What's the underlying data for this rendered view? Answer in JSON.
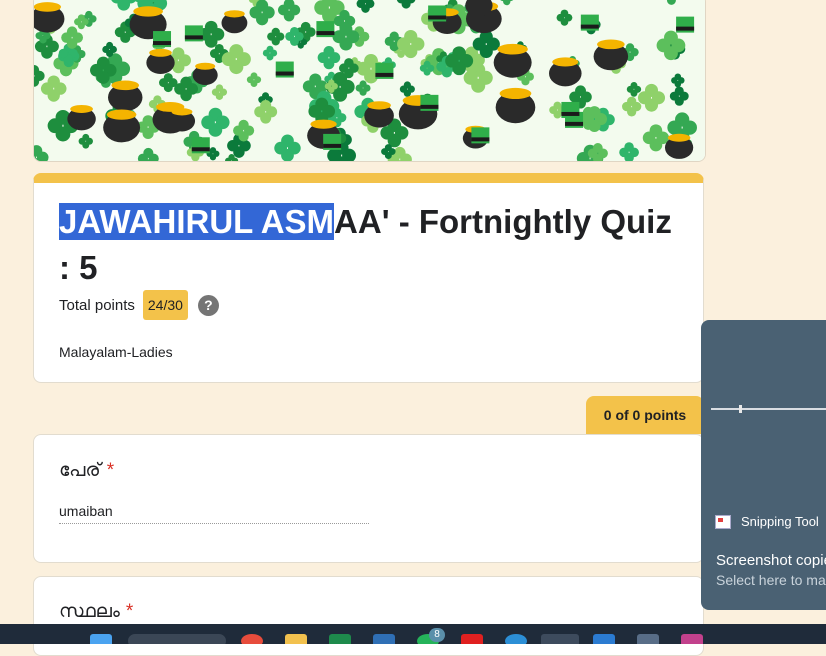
{
  "form": {
    "title_selected": "JAWAHIRUL ASM",
    "title_rest": "AA' - Fortnightly Quiz : 5",
    "total_points_label": "Total points",
    "score": "24/30",
    "help_icon": "help-circle-icon",
    "subtitle": "Malayalam-Ladies"
  },
  "section_points": "0 of 0 points",
  "questions": [
    {
      "label": "പേര്",
      "required_mark": "*",
      "answer": "umaiban"
    },
    {
      "label": "സ്ഥലം",
      "required_mark": "*"
    }
  ],
  "notification": {
    "app_name": "Snipping Tool",
    "heading": "Screenshot copie",
    "body": "Select here to ma"
  },
  "taskbar": {
    "badge_count": "8",
    "icons": [
      "windows-start-icon",
      "search-icon",
      "chrome-icon",
      "file-explorer-icon",
      "excel-icon",
      "app-icon",
      "whatsapp-icon",
      "youtube-icon",
      "browser-icon",
      "edge-icon",
      "vscode-icon",
      "app-icon",
      "instagram-icon"
    ]
  },
  "colors": {
    "accent": "#f3c24a",
    "background": "#fbf0dd",
    "selection": "#3367d6",
    "required": "#d93025"
  }
}
